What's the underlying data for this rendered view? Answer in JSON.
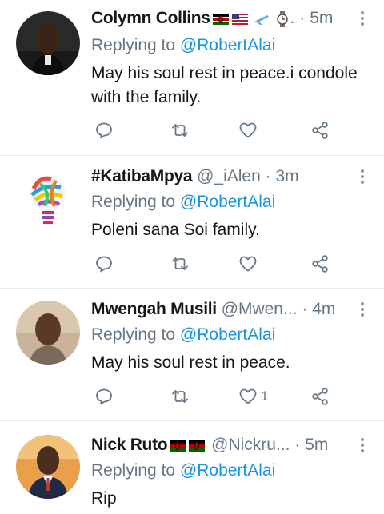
{
  "tweets": [
    {
      "name": "Colymn Collins",
      "handle": "",
      "time": "5m",
      "reply_prefix": "Replying to",
      "reply_to": "@RobertAlai",
      "text": "May his soul rest in peace.i condole with the family.",
      "likes": "",
      "avatar_icon": "profile-photo"
    },
    {
      "name": "#KatibaMpya",
      "handle": "@_iAlen",
      "time": "3m",
      "reply_prefix": "Replying to",
      "reply_to": "@RobertAlai",
      "text": "Poleni sana Soi family.",
      "likes": "",
      "avatar_icon": "lightbulb-icon"
    },
    {
      "name": "Mwengah Musili",
      "handle": "@Mwen...",
      "time": "4m",
      "reply_prefix": "Replying to",
      "reply_to": "@RobertAlai",
      "text": "May his soul rest in peace.",
      "likes": "1",
      "avatar_icon": "profile-photo"
    },
    {
      "name": "Nick Ruto",
      "handle": "@Nickru...",
      "time": "5m",
      "reply_prefix": "Replying to",
      "reply_to": "@RobertAlai",
      "text": "Rip",
      "likes": "",
      "avatar_icon": "profile-photo"
    }
  ],
  "separator": "·",
  "colors": {
    "text": "#14171a",
    "muted": "#657786",
    "mention": "#1b95e0",
    "icon": "#657786",
    "divider": "#e6ecf0"
  }
}
